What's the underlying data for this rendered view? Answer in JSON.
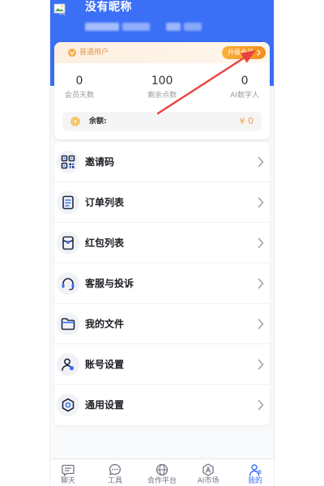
{
  "header": {
    "avatar_icon": "broken-image-icon",
    "nickname": "没有昵称"
  },
  "member_card": {
    "level_icon": "member-badge-icon",
    "level_label": "普通用户",
    "upgrade_label": "升级会员",
    "stats": [
      {
        "value": "0",
        "label": "会员天数"
      },
      {
        "value": "100",
        "label": "剩余点数"
      },
      {
        "value": "0",
        "label": "AI数字人"
      }
    ],
    "balance_icon": "coin-icon",
    "balance_label": "余额:",
    "balance_value": "¥ 0"
  },
  "menu": [
    {
      "label": "邀请码",
      "icon": "qr-code-icon"
    },
    {
      "label": "订单列表",
      "icon": "document-icon"
    },
    {
      "label": "红包列表",
      "icon": "red-envelope-icon"
    },
    {
      "label": "客服与投诉",
      "icon": "headset-icon"
    },
    {
      "label": "我的文件",
      "icon": "folder-icon"
    },
    {
      "label": "账号设置",
      "icon": "user-settings-icon"
    },
    {
      "label": "通用设置",
      "icon": "gear-icon"
    }
  ],
  "tabbar": [
    {
      "label": "聊天",
      "icon": "chat-icon",
      "active": false
    },
    {
      "label": "工具",
      "icon": "speech-bubble-icon",
      "active": false
    },
    {
      "label": "合作平台",
      "icon": "planet-icon",
      "active": false
    },
    {
      "label": "AI市场",
      "icon": "ai-hexagon-icon",
      "active": false
    },
    {
      "label": "我的",
      "icon": "user-icon",
      "active": true
    }
  ],
  "colors": {
    "header_blue": "#3a6ff6",
    "member_orange": "#f39a2b",
    "balance_orange": "#f1a148",
    "annotation_red": "#e8443f",
    "icon_navy": "#1f2a44"
  }
}
